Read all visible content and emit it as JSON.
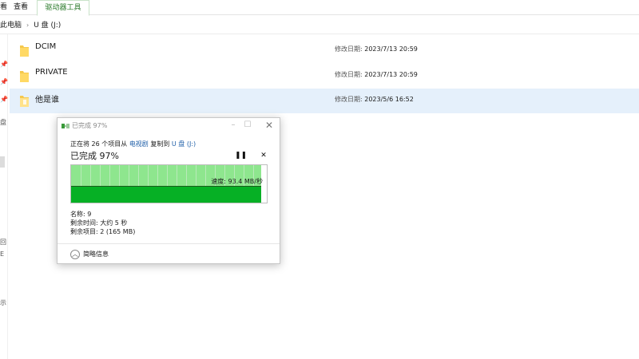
{
  "ribbon": {
    "tabs": [
      "看",
      "查看",
      "驱动器工具"
    ],
    "active_tab_color": "#2a7a2a"
  },
  "address": {
    "parts": [
      "此电脑",
      "U 盘 (J:)"
    ],
    "separator": "›"
  },
  "nav_glyphs": [
    "盘",
    "回",
    "E",
    "示"
  ],
  "files": [
    {
      "name": "DCIM",
      "date_label": "修改日期:",
      "date": "2023/7/13 20:59",
      "icon": "folder-icon"
    },
    {
      "name": "PRIVATE",
      "date_label": "修改日期:",
      "date": "2023/7/13 20:59",
      "icon": "folder-icon"
    },
    {
      "name": "他是谁",
      "date_label": "修改日期:",
      "date": "2023/5/6 16:52",
      "icon": "folder-open-icon"
    }
  ],
  "dialog": {
    "title": "已完成 97%",
    "line_prefix": "正在将 26 个项目从 ",
    "source": "电视剧",
    "line_mid": " 复制到 ",
    "dest": "U 盘 (J:)",
    "percent_text": "已完成 97%",
    "progress_fraction": 0.97,
    "speed": "速度: 93.4 MB/秒",
    "name_line": "名称: 9",
    "time_left": "剩余时间: 大约 5 秒",
    "items_left": "剩余项目: 2 (165 MB)",
    "less_details": "简略信息",
    "pause_glyph": "❚❚",
    "stop_glyph": "✕",
    "colors": {
      "graph_light": "#8ee68e",
      "graph_dark": "#06b025",
      "link": "#1f5fa8"
    }
  }
}
